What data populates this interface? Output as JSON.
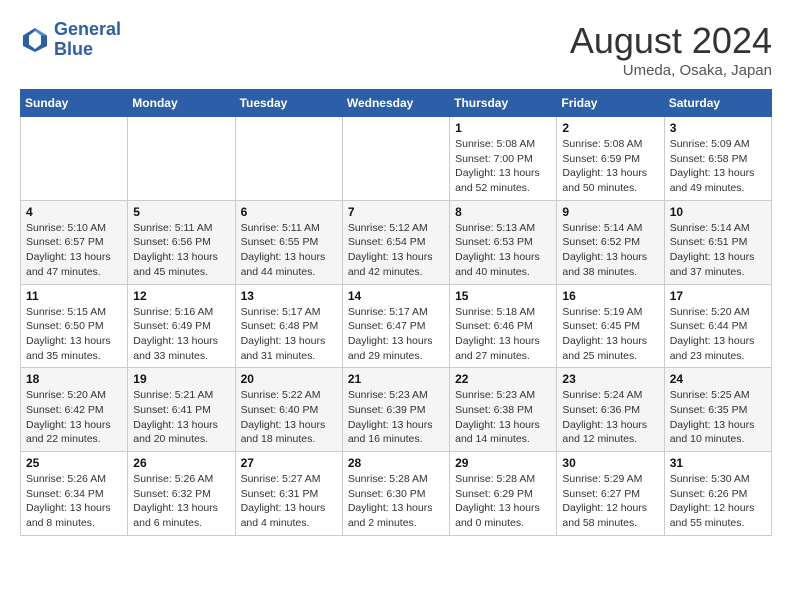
{
  "header": {
    "logo_line1": "General",
    "logo_line2": "Blue",
    "month_year": "August 2024",
    "location": "Umeda, Osaka, Japan"
  },
  "weekdays": [
    "Sunday",
    "Monday",
    "Tuesday",
    "Wednesday",
    "Thursday",
    "Friday",
    "Saturday"
  ],
  "weeks": [
    [
      {
        "day": "",
        "info": ""
      },
      {
        "day": "",
        "info": ""
      },
      {
        "day": "",
        "info": ""
      },
      {
        "day": "",
        "info": ""
      },
      {
        "day": "1",
        "info": "Sunrise: 5:08 AM\nSunset: 7:00 PM\nDaylight: 13 hours\nand 52 minutes."
      },
      {
        "day": "2",
        "info": "Sunrise: 5:08 AM\nSunset: 6:59 PM\nDaylight: 13 hours\nand 50 minutes."
      },
      {
        "day": "3",
        "info": "Sunrise: 5:09 AM\nSunset: 6:58 PM\nDaylight: 13 hours\nand 49 minutes."
      }
    ],
    [
      {
        "day": "4",
        "info": "Sunrise: 5:10 AM\nSunset: 6:57 PM\nDaylight: 13 hours\nand 47 minutes."
      },
      {
        "day": "5",
        "info": "Sunrise: 5:11 AM\nSunset: 6:56 PM\nDaylight: 13 hours\nand 45 minutes."
      },
      {
        "day": "6",
        "info": "Sunrise: 5:11 AM\nSunset: 6:55 PM\nDaylight: 13 hours\nand 44 minutes."
      },
      {
        "day": "7",
        "info": "Sunrise: 5:12 AM\nSunset: 6:54 PM\nDaylight: 13 hours\nand 42 minutes."
      },
      {
        "day": "8",
        "info": "Sunrise: 5:13 AM\nSunset: 6:53 PM\nDaylight: 13 hours\nand 40 minutes."
      },
      {
        "day": "9",
        "info": "Sunrise: 5:14 AM\nSunset: 6:52 PM\nDaylight: 13 hours\nand 38 minutes."
      },
      {
        "day": "10",
        "info": "Sunrise: 5:14 AM\nSunset: 6:51 PM\nDaylight: 13 hours\nand 37 minutes."
      }
    ],
    [
      {
        "day": "11",
        "info": "Sunrise: 5:15 AM\nSunset: 6:50 PM\nDaylight: 13 hours\nand 35 minutes."
      },
      {
        "day": "12",
        "info": "Sunrise: 5:16 AM\nSunset: 6:49 PM\nDaylight: 13 hours\nand 33 minutes."
      },
      {
        "day": "13",
        "info": "Sunrise: 5:17 AM\nSunset: 6:48 PM\nDaylight: 13 hours\nand 31 minutes."
      },
      {
        "day": "14",
        "info": "Sunrise: 5:17 AM\nSunset: 6:47 PM\nDaylight: 13 hours\nand 29 minutes."
      },
      {
        "day": "15",
        "info": "Sunrise: 5:18 AM\nSunset: 6:46 PM\nDaylight: 13 hours\nand 27 minutes."
      },
      {
        "day": "16",
        "info": "Sunrise: 5:19 AM\nSunset: 6:45 PM\nDaylight: 13 hours\nand 25 minutes."
      },
      {
        "day": "17",
        "info": "Sunrise: 5:20 AM\nSunset: 6:44 PM\nDaylight: 13 hours\nand 23 minutes."
      }
    ],
    [
      {
        "day": "18",
        "info": "Sunrise: 5:20 AM\nSunset: 6:42 PM\nDaylight: 13 hours\nand 22 minutes."
      },
      {
        "day": "19",
        "info": "Sunrise: 5:21 AM\nSunset: 6:41 PM\nDaylight: 13 hours\nand 20 minutes."
      },
      {
        "day": "20",
        "info": "Sunrise: 5:22 AM\nSunset: 6:40 PM\nDaylight: 13 hours\nand 18 minutes."
      },
      {
        "day": "21",
        "info": "Sunrise: 5:23 AM\nSunset: 6:39 PM\nDaylight: 13 hours\nand 16 minutes."
      },
      {
        "day": "22",
        "info": "Sunrise: 5:23 AM\nSunset: 6:38 PM\nDaylight: 13 hours\nand 14 minutes."
      },
      {
        "day": "23",
        "info": "Sunrise: 5:24 AM\nSunset: 6:36 PM\nDaylight: 13 hours\nand 12 minutes."
      },
      {
        "day": "24",
        "info": "Sunrise: 5:25 AM\nSunset: 6:35 PM\nDaylight: 13 hours\nand 10 minutes."
      }
    ],
    [
      {
        "day": "25",
        "info": "Sunrise: 5:26 AM\nSunset: 6:34 PM\nDaylight: 13 hours\nand 8 minutes."
      },
      {
        "day": "26",
        "info": "Sunrise: 5:26 AM\nSunset: 6:32 PM\nDaylight: 13 hours\nand 6 minutes."
      },
      {
        "day": "27",
        "info": "Sunrise: 5:27 AM\nSunset: 6:31 PM\nDaylight: 13 hours\nand 4 minutes."
      },
      {
        "day": "28",
        "info": "Sunrise: 5:28 AM\nSunset: 6:30 PM\nDaylight: 13 hours\nand 2 minutes."
      },
      {
        "day": "29",
        "info": "Sunrise: 5:28 AM\nSunset: 6:29 PM\nDaylight: 13 hours\nand 0 minutes."
      },
      {
        "day": "30",
        "info": "Sunrise: 5:29 AM\nSunset: 6:27 PM\nDaylight: 12 hours\nand 58 minutes."
      },
      {
        "day": "31",
        "info": "Sunrise: 5:30 AM\nSunset: 6:26 PM\nDaylight: 12 hours\nand 55 minutes."
      }
    ]
  ]
}
